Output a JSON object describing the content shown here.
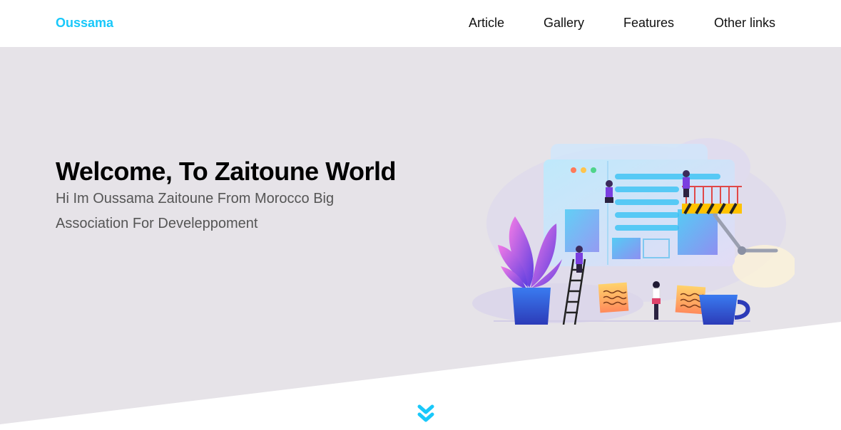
{
  "header": {
    "logo_text": "Oussama",
    "nav": [
      {
        "label": "Article"
      },
      {
        "label": "Gallery"
      },
      {
        "label": "Features"
      },
      {
        "label": "Other links"
      }
    ]
  },
  "hero": {
    "title": "Welcome, To Zaitoune World",
    "subtitle": "Hi Im Oussama Zaitoune From Morocco Big Association For Develeppoment",
    "scroll_icon": "double-chevron-down-icon"
  },
  "colors": {
    "accent": "#19c8fa",
    "hero_background": "#e6e3e8",
    "title_text": "#000000",
    "subtitle_text": "#555555"
  }
}
